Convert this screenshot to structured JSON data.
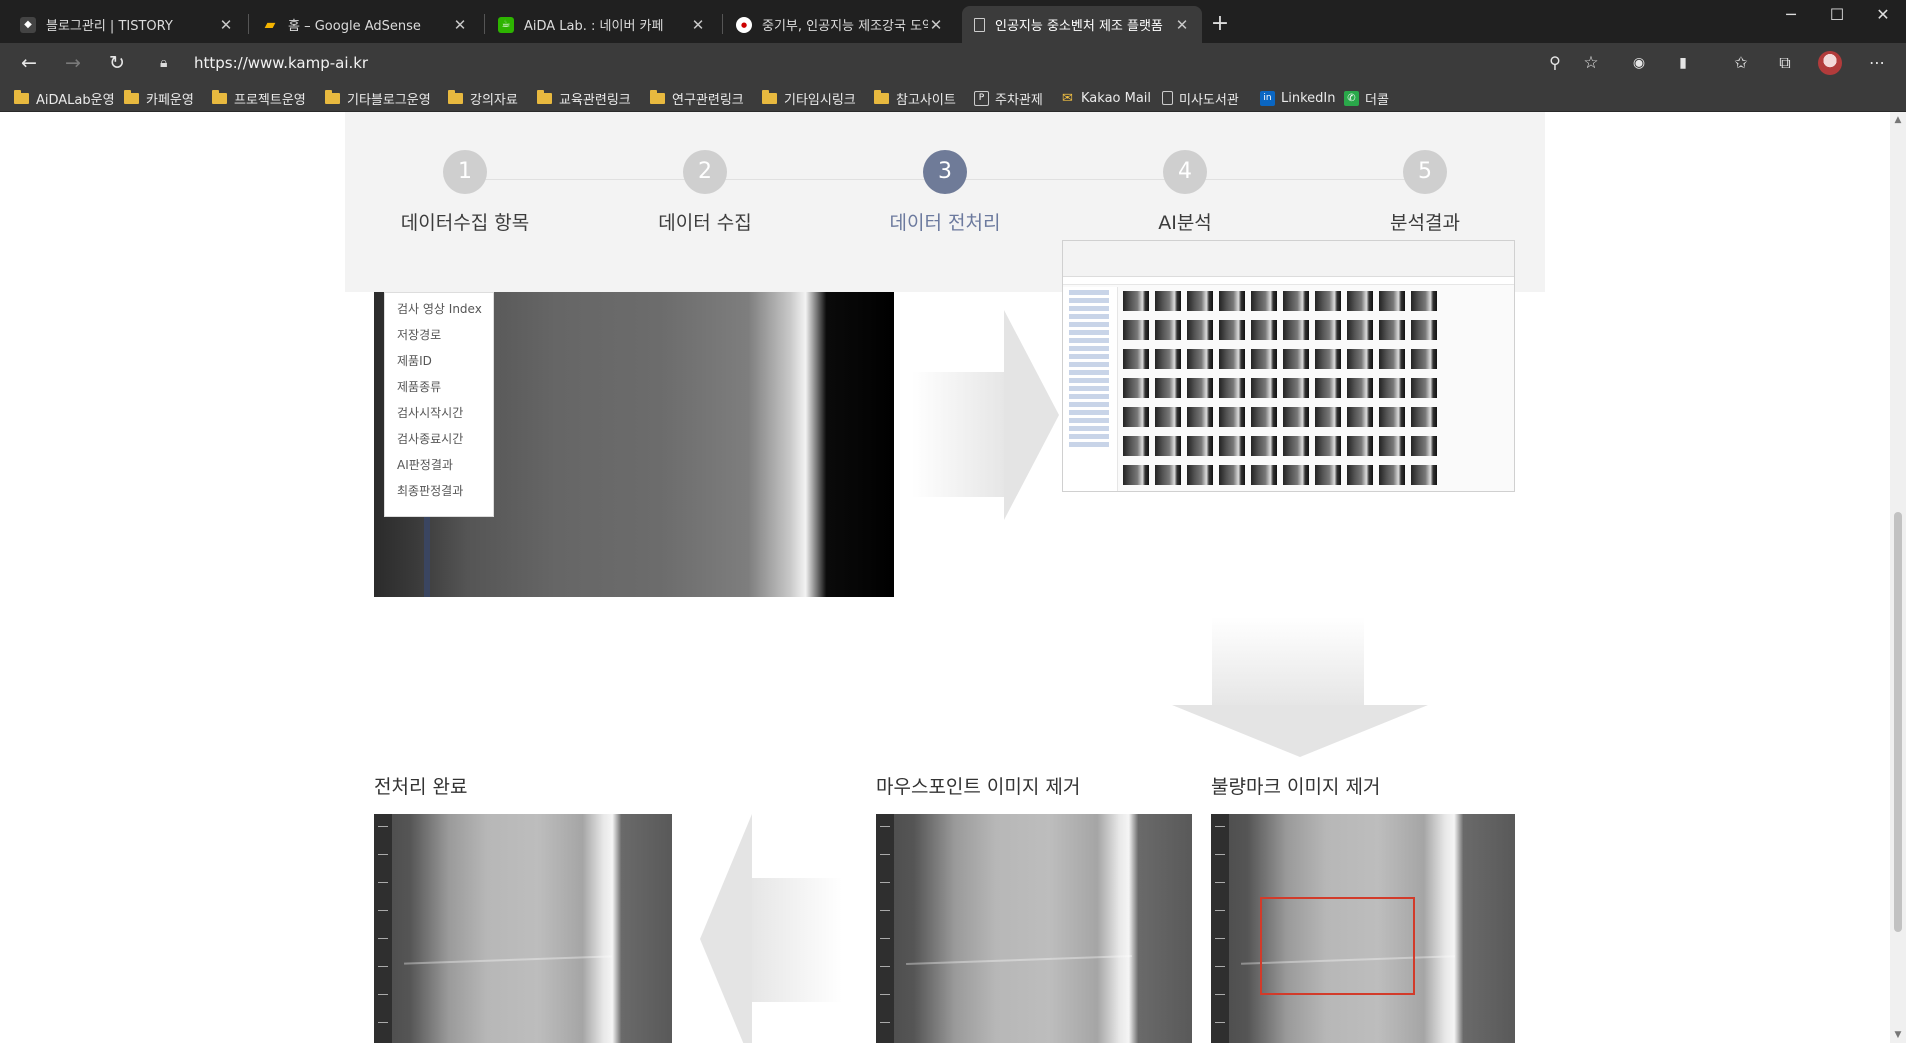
{
  "browser": {
    "tabs": [
      {
        "title": "블로그관리 | TISTORY",
        "favicon": "tistory-icon",
        "color": "#444444",
        "active": false
      },
      {
        "title": "홈 – Google AdSense",
        "favicon": "adsense-icon",
        "color": "#f4b400",
        "active": false
      },
      {
        "title": "AiDA Lab. : 네이버 카페",
        "favicon": "naver-cafe-icon",
        "color": "#2db400",
        "active": false
      },
      {
        "title": "중기부, 인공지능 제조강국 도약",
        "favicon": "news-icon",
        "color": "#ffffff",
        "active": false
      },
      {
        "title": "인공지능 중소벤처 제조 플랫폼",
        "favicon": "page-icon",
        "color": "#dddddd",
        "active": true
      }
    ],
    "url": "https://www.kamp-ai.kr",
    "bookmarks": [
      {
        "label": "AiDALab운영",
        "icon": "folder-icon"
      },
      {
        "label": "카페운영",
        "icon": "folder-icon"
      },
      {
        "label": "프로젝트운영",
        "icon": "folder-icon"
      },
      {
        "label": "기타블로그운영",
        "icon": "folder-icon"
      },
      {
        "label": "강의자료",
        "icon": "folder-icon"
      },
      {
        "label": "교육관련링크",
        "icon": "folder-icon"
      },
      {
        "label": "연구관련링크",
        "icon": "folder-icon"
      },
      {
        "label": "기타임시링크",
        "icon": "folder-icon"
      },
      {
        "label": "참고사이트",
        "icon": "folder-icon"
      },
      {
        "label": "주차관제",
        "icon": "parking-icon"
      },
      {
        "label": "Kakao Mail",
        "icon": "mail-icon"
      },
      {
        "label": "미사도서관",
        "icon": "page-icon"
      },
      {
        "label": "LinkedIn",
        "icon": "linkedin-icon"
      },
      {
        "label": "더콜",
        "icon": "phone-icon"
      }
    ]
  },
  "steps": [
    {
      "num": "1",
      "label": "데이터수집 항목",
      "active": false
    },
    {
      "num": "2",
      "label": "데이터 수집",
      "active": false
    },
    {
      "num": "3",
      "label": "데이터 전처리",
      "active": true
    },
    {
      "num": "4",
      "label": "AI분석",
      "active": false
    },
    {
      "num": "5",
      "label": "분석결과",
      "active": false
    }
  ],
  "data_fields": [
    "검사 영상 Index",
    "저장경로",
    "제품ID",
    "제품종류",
    "검사시작시간",
    "검사종료시간",
    "AI판정결과",
    "최종판정결과"
  ],
  "sections": {
    "done": "전처리 완료",
    "mouse_removed": "마우스포인트 이미지 제거",
    "defect_removed": "불량마크 이미지 제거"
  },
  "colors": {
    "active_step": "#6f7b98",
    "inactive_step": "#cfcfcf",
    "defect_mark": "#d23b2a"
  }
}
